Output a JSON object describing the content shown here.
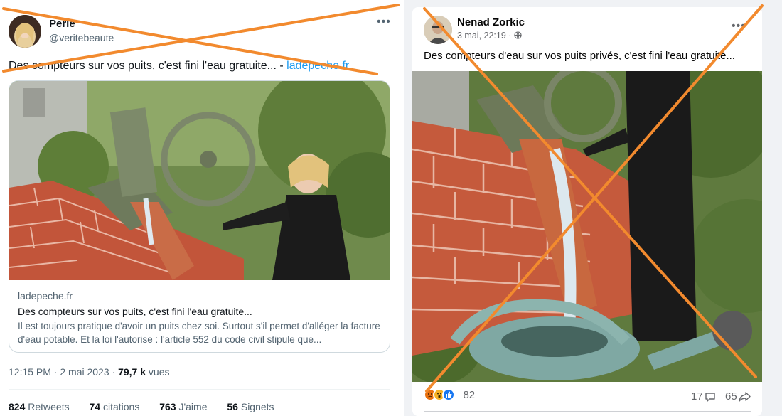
{
  "tweet": {
    "author_name": "Perle",
    "author_handle": "@veritebeaute",
    "text": "Des compteurs sur vos puits, c'est fini l'eau gratuite... - ",
    "text_link": "ladepeche.fr",
    "card": {
      "domain": "ladepeche.fr",
      "title": "Des compteurs sur vos puits, c'est fini l'eau gratuite...",
      "description": "Il est toujours pratique d'avoir un puits chez soi. Surtout s'il permet d'alléger la facture d'eau potable. Et la loi l'autorise : l'article 552 du code civil stipule que..."
    },
    "timestamp": "12:15 PM · 2 mai 2023 · ",
    "views_count": "79,7 k",
    "views_label": " vues",
    "stats": {
      "retweets_count": "824",
      "retweets_label": "Retweets",
      "quotes_count": "74",
      "quotes_label": "citations",
      "likes_count": "763",
      "likes_label": "J'aime",
      "bookmarks_count": "56",
      "bookmarks_label": "Signets"
    },
    "more_icon": "ellipsis-icon"
  },
  "facebook_post": {
    "author_name": "Nenad Zorkic",
    "post_time": "3 mai, 22:19 · ",
    "audience_icon": "globe-icon",
    "text": "Des compteurs d'eau sur vos puits privés, c'est fini l'eau gratuite...",
    "reactions": [
      "angry",
      "wow",
      "like"
    ],
    "reaction_count": "82",
    "comment_count": "17",
    "share_count": "65",
    "comment_icon": "comment-icon",
    "share_icon": "share-icon",
    "more_icon": "ellipsis-icon"
  },
  "overlay": {
    "cross_color": "#f28a2e"
  },
  "colors": {
    "twitter_link": "#1d9bf0",
    "secondary_text": "#536471",
    "facebook_bg": "#f0f2f5"
  }
}
